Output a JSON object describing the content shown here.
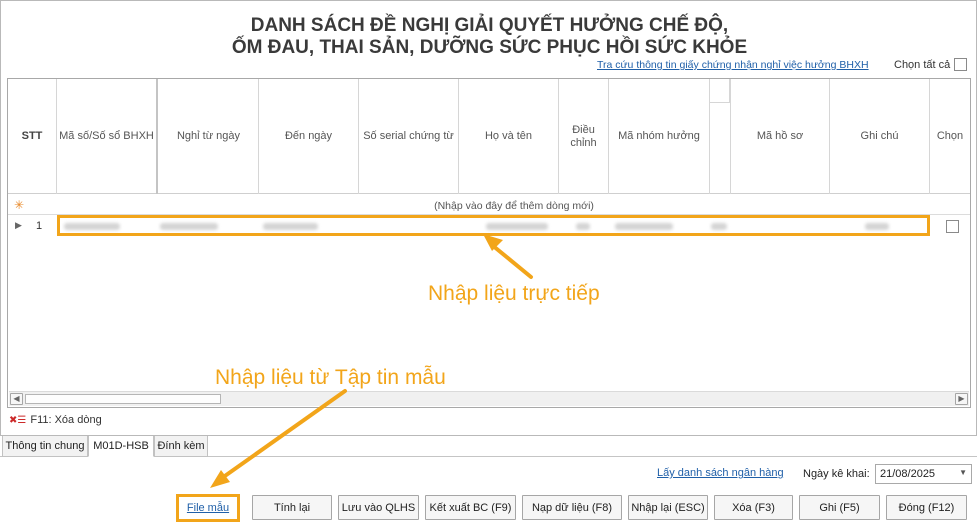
{
  "title_line1": "DANH SÁCH ĐỀ NGHỊ GIẢI QUYẾT HƯỞNG CHẾ ĐỘ,",
  "title_line2": "ỐM ĐAU, THAI SẢN, DƯỠNG SỨC PHỤC HỒI SỨC KHỎE",
  "lookup_link": "Tra cứu thông tin giấy chứng nhận nghỉ việc hưởng BHXH",
  "select_all_label": "Chọn tất cả",
  "columns": [
    {
      "label": "STT"
    },
    {
      "label": "Mã số/Số sổ BHXH"
    },
    {
      "label": "Nghỉ từ ngày"
    },
    {
      "label": "Đến ngày"
    },
    {
      "label": "Số serial chứng từ"
    },
    {
      "label": "Họ và tên"
    },
    {
      "label": "Điều chỉnh"
    },
    {
      "label": "Mã nhóm hưởng"
    },
    {
      "label": "Mã hồ sơ"
    },
    {
      "label": "Ghi chú"
    },
    {
      "label": "Chọn"
    }
  ],
  "new_row_hint": "(Nhập vào đây để thêm dòng mới)",
  "row1_index": "1",
  "delete_row_label": "F11: Xóa dòng",
  "tabs": [
    {
      "label": "Thông tin chung"
    },
    {
      "label": "M01D-HSB"
    },
    {
      "label": "Đính kèm"
    }
  ],
  "bank_link": "Lấy danh sách ngân hàng",
  "declare_date_label": "Ngày kê khai:",
  "declare_date_value": "21/08/2025",
  "buttons": {
    "file_sample": "File mẫu",
    "recalc": "Tính lại",
    "save_qlhs": "Lưu vào QLHS",
    "export": "Kết xuất BC (F9)",
    "load_data": "Nạp dữ liệu (F8)",
    "reenter": "Nhập lại (ESC)",
    "delete": "Xóa (F3)",
    "save": "Ghi (F5)",
    "close": "Đóng (F12)"
  },
  "annotations": {
    "direct": "Nhập liệu trực tiếp",
    "from_file": "Nhập liệu từ Tập tin mẫu"
  },
  "colors": {
    "highlight": "#f2a51a",
    "link": "#1f5fa8"
  }
}
